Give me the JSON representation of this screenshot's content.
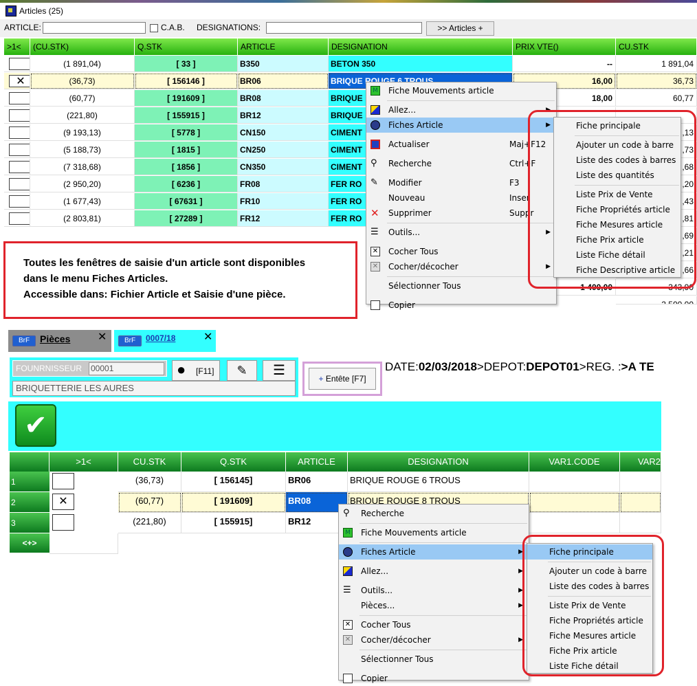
{
  "top_window": {
    "title": "Articles (25)",
    "search": {
      "article_label": "ARTICLE:",
      "cab_label": "C.A.B.",
      "designations_label": "DESIGNATIONS:",
      "button_label": ">> Articles +"
    },
    "columns": [
      ">1<",
      "(CU.STK)",
      "Q.STK",
      "ARTICLE",
      "DESIGNATION",
      "PRIX VTE()",
      "CU.STK"
    ],
    "rows": [
      {
        "cu_paren": "(1 891,04)",
        "qstk": "[ 33 ]",
        "article": "B350",
        "designation": "BETON 350",
        "prix": "--",
        "custk": "1 891,04",
        "checked": false
      },
      {
        "cu_paren": "(36,73)",
        "qstk": "[ 156146 ]",
        "article": "BR06",
        "designation": "BRIQUE ROUGE 6 TROUS",
        "prix": "16,00",
        "custk": "36,73",
        "checked": true
      },
      {
        "cu_paren": "(60,77)",
        "qstk": "[ 191609 ]",
        "article": "BR08",
        "designation": "BRIQUE",
        "prix": "18,00",
        "custk": "60,77",
        "checked": false
      },
      {
        "cu_paren": "(221,80)",
        "qstk": "[ 155915 ]",
        "article": "BR12",
        "designation": "BRIQUE",
        "prix": "",
        "custk": "",
        "checked": false
      },
      {
        "cu_paren": "(9 193,13)",
        "qstk": "[ 5778 ]",
        "article": "CN150",
        "designation": "CIMENT",
        "prix": "",
        "custk": ",13",
        "checked": false
      },
      {
        "cu_paren": "(5 188,73)",
        "qstk": "[ 1815 ]",
        "article": "CN250",
        "designation": "CIMENT",
        "prix": "",
        "custk": ",73",
        "checked": false
      },
      {
        "cu_paren": "(7 318,68)",
        "qstk": "[ 1856 ]",
        "article": "CN350",
        "designation": "CIMENT",
        "prix": "",
        "custk": ",68",
        "checked": false
      },
      {
        "cu_paren": "(2 950,20)",
        "qstk": "[ 6236 ]",
        "article": "FR08",
        "designation": "FER RO",
        "prix": "",
        "custk": ",20",
        "checked": false
      },
      {
        "cu_paren": "(1 677,43)",
        "qstk": "[ 67631 ]",
        "article": "FR10",
        "designation": "FER RO",
        "prix": "",
        "custk": ",43",
        "checked": false
      },
      {
        "cu_paren": "(2 803,81)",
        "qstk": "[ 27289 ]",
        "article": "FR12",
        "designation": "FER RO",
        "prix": "",
        "custk": ",81",
        "checked": false
      }
    ],
    "partial_row_values": {
      "r11_custk": ",69",
      "r12_custk": ",21",
      "r13_custk": ",66",
      "r14_prix": "1 400,00",
      "r14_custk": "343,90",
      "r15_custk": "2 500,00"
    },
    "context_menu": [
      {
        "label": "Fiche Mouvements article",
        "icon": "mouvement-icon",
        "shortcut": "",
        "submenu": false
      },
      {
        "label": "Allez...",
        "icon": "allez-icon",
        "shortcut": "",
        "submenu": true
      },
      {
        "label": "Fiches Article",
        "icon": "fiches-icon",
        "shortcut": "",
        "submenu": true,
        "highlighted": true
      },
      {
        "label": "Actualiser",
        "icon": "refresh-icon",
        "shortcut": "Maj+F12",
        "submenu": false
      },
      {
        "label": "Recherche",
        "icon": "binoculars-icon",
        "shortcut": "Ctrl+F",
        "submenu": false
      },
      {
        "label": "Modifier",
        "icon": "edit-icon",
        "shortcut": "F3",
        "submenu": false
      },
      {
        "label": "Nouveau",
        "icon": "",
        "shortcut": "Inser",
        "submenu": false
      },
      {
        "label": "Supprimer",
        "icon": "delete-icon",
        "shortcut": "Suppr",
        "submenu": false
      },
      {
        "label": "Outils...",
        "icon": "tools-icon",
        "shortcut": "",
        "submenu": true
      },
      {
        "label": "Cocher Tous",
        "icon": "check-all-icon",
        "shortcut": "",
        "submenu": false
      },
      {
        "label": "Cocher/décocher",
        "icon": "toggle-check-icon",
        "shortcut": "",
        "submenu": true
      },
      {
        "label": "Sélectionner Tous",
        "icon": "",
        "shortcut": "",
        "submenu": false
      },
      {
        "label": "Copier",
        "icon": "copy-icon",
        "shortcut": "",
        "submenu": false
      }
    ],
    "submenu": [
      "Fiche principale",
      "Ajouter un code à barre",
      "Liste des codes à barres",
      "Liste des quantités",
      "Liste Prix de Vente",
      "Fiche Propriétés article",
      "Fiche Mesures article",
      "Fiche Prix article",
      "Liste Fiche détail",
      "Fiche Descriptive article"
    ]
  },
  "annotation": {
    "line1": "Toutes les fenêtres de saisie d'un article sont disponibles",
    "line2": "dans le menu Fiches Articles.",
    "line3": "Accessible dans:  Fichier Article et Saisie d'une pièce."
  },
  "bottom_window": {
    "tabs": [
      {
        "badge": "BrF",
        "label": "Pièces"
      },
      {
        "badge": "BrF",
        "label": "0007/18"
      }
    ],
    "fournisseur_label": "FOUNRNISSEUR",
    "fournisseur_code": "00001",
    "fournisseur_name": "BRIQUETTERIE LES AURES",
    "f11_label": "[F11]",
    "entete_label": "Entête [F7]",
    "header_info": {
      "date_label": "DATE:",
      "date_value": "02/03/2018",
      "depot_label": ">DEPOT:",
      "depot_value": "DEPOT01",
      "reg_label": ">REG. :",
      "reg_value": ">A TE"
    },
    "columns": [
      ">1<",
      "CU.STK",
      "Q.STK",
      "ARTICLE",
      "DESIGNATION",
      "VAR1.CODE",
      "VAR2"
    ],
    "rows": [
      {
        "num": "1",
        "cu": "(36,73)",
        "qstk": "[ 156145]",
        "article": "BR06",
        "designation": "BRIQUE ROUGE 6 TROUS",
        "checked": false
      },
      {
        "num": "2",
        "cu": "(60,77)",
        "qstk": "[ 191609]",
        "article": "BR08",
        "designation": "BRIQUE ROUGE 8 TROUS",
        "checked": true
      },
      {
        "num": "3",
        "cu": "(221,80)",
        "qstk": "[ 155915]",
        "article": "BR12",
        "designation": "",
        "checked": false
      }
    ],
    "add_row_label": "<+>",
    "context_menu": [
      {
        "label": "Recherche",
        "icon": "binoculars-icon",
        "submenu": false
      },
      {
        "label": "Fiche Mouvements article",
        "icon": "mouvement-icon",
        "submenu": false
      },
      {
        "label": "Fiches Article",
        "icon": "fiches-icon",
        "submenu": true,
        "highlighted": true
      },
      {
        "label": "Allez...",
        "icon": "allez-icon",
        "submenu": true
      },
      {
        "label": "Outils...",
        "icon": "tools-icon",
        "submenu": true
      },
      {
        "label": "Pièces...",
        "icon": "",
        "submenu": true
      },
      {
        "label": "Cocher Tous",
        "icon": "check-all-icon",
        "submenu": false
      },
      {
        "label": "Cocher/décocher",
        "icon": "toggle-check-icon",
        "submenu": true
      },
      {
        "label": "Sélectionner Tous",
        "icon": "",
        "submenu": false
      },
      {
        "label": "Copier",
        "icon": "copy-icon",
        "submenu": false
      }
    ],
    "submenu": [
      "Fiche principale",
      "Ajouter un code à barre",
      "Liste des codes à barres",
      "Liste Prix de Vente",
      "Fiche Propriétés article",
      "Fiche Mesures article",
      "Fiche Prix article",
      "Liste Fiche détail"
    ]
  },
  "colors": {
    "accent_red": "#e0232b",
    "grid_green": "#27b10f",
    "cyan": "#33ffff",
    "menu_highlight": "#99c9f4",
    "selection_blue": "#0a64d8"
  }
}
